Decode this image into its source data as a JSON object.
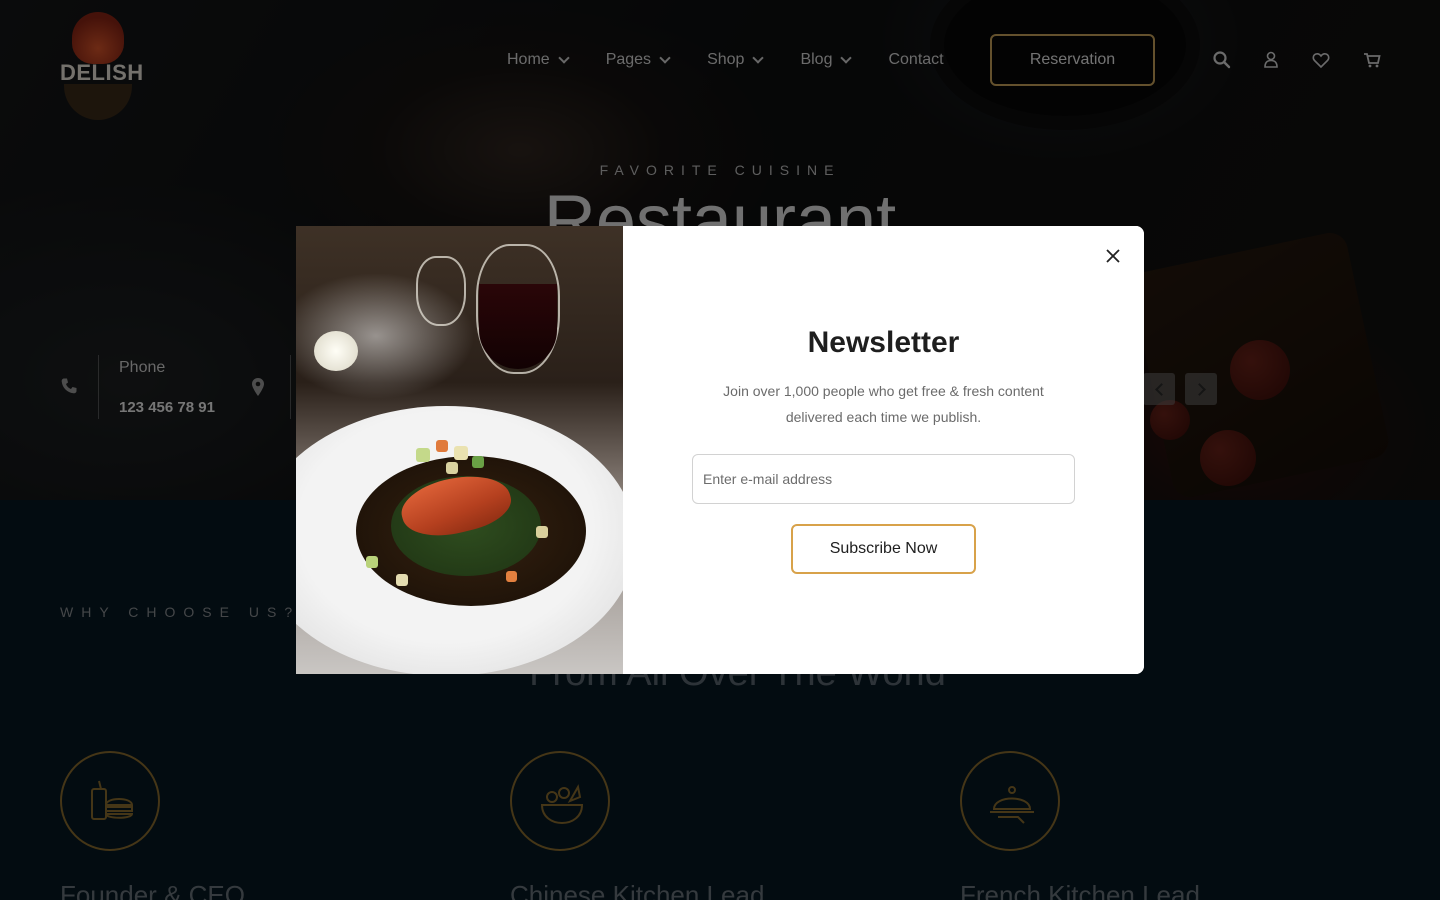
{
  "brand": {
    "logo_text": "DELISH"
  },
  "nav": {
    "items": [
      {
        "label": "Home",
        "has_dropdown": true
      },
      {
        "label": "Pages",
        "has_dropdown": true
      },
      {
        "label": "Shop",
        "has_dropdown": true
      },
      {
        "label": "Blog",
        "has_dropdown": true
      },
      {
        "label": "Contact",
        "has_dropdown": false
      }
    ],
    "reservation_label": "Reservation",
    "icons": [
      "search-icon",
      "user-icon",
      "heart-icon",
      "cart-icon"
    ]
  },
  "hero": {
    "subtitle": "FAVORITE CUISINE",
    "title": "Restaurant",
    "contact": {
      "phone_label": "Phone",
      "phone_value": "123 456 78 91"
    }
  },
  "section": {
    "eyebrow": "WHY CHOOSE US?",
    "title": "From All Over The World",
    "features": [
      {
        "title": "Founder & CEO",
        "icon": "fast-food-icon"
      },
      {
        "title": "Chinese Kitchen Lead",
        "icon": "salad-bowl-icon"
      },
      {
        "title": "French Kitchen Lead",
        "icon": "serving-cloche-icon"
      }
    ]
  },
  "newsletter": {
    "title": "Newsletter",
    "description": "Join over 1,000 people who get free & fresh content delivered each time we publish.",
    "email_placeholder": "Enter e-mail address",
    "button_label": "Subscribe Now"
  },
  "colors": {
    "accent": "#c9a35a",
    "button_border": "#d8a24a",
    "page_bg": "#061822"
  }
}
